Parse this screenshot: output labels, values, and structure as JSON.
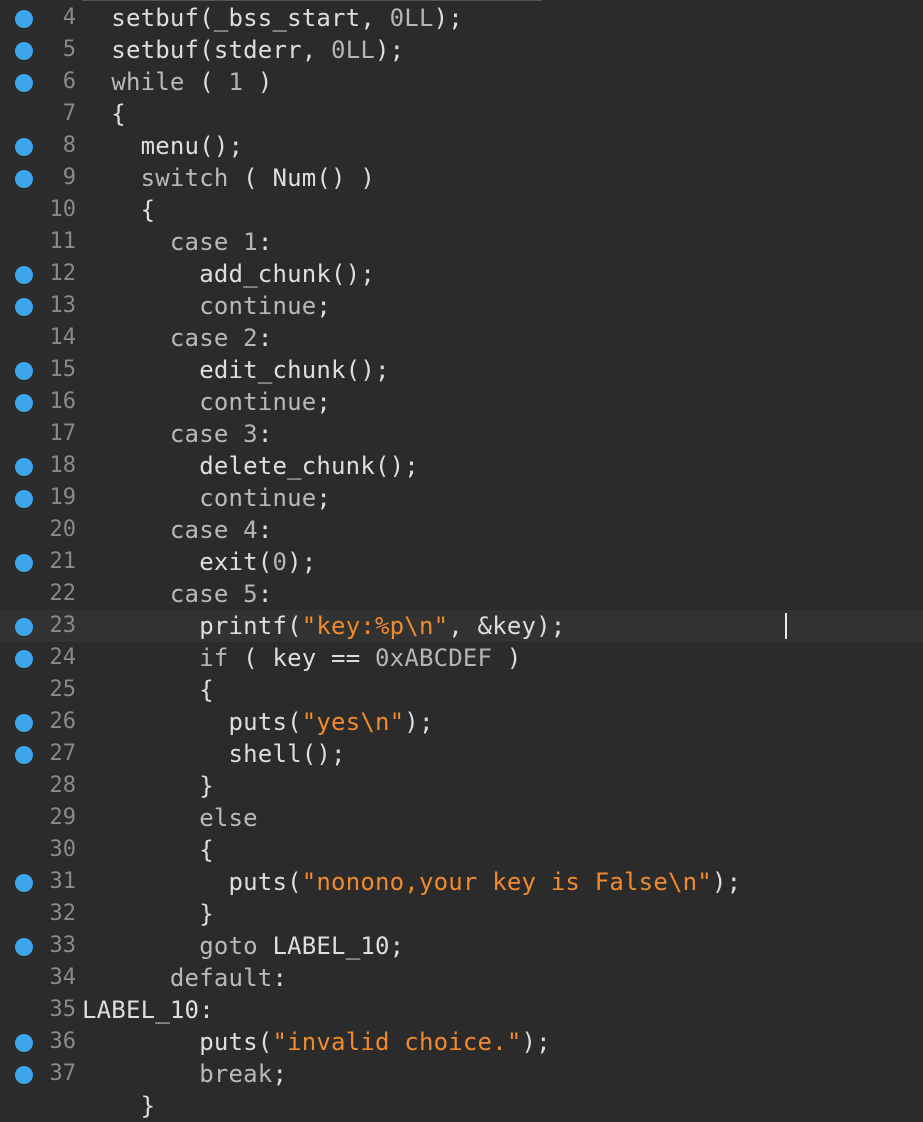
{
  "editor": {
    "lines": [
      {
        "n": "4",
        "bp": true,
        "current": false,
        "parts": [
          {
            "t": "  setbuf(_bss_start, "
          },
          {
            "t": "0LL",
            "c": "num"
          },
          {
            "t": ");"
          }
        ]
      },
      {
        "n": "5",
        "bp": true,
        "current": false,
        "parts": [
          {
            "t": "  setbuf(stderr, "
          },
          {
            "t": "0LL",
            "c": "num"
          },
          {
            "t": ");"
          }
        ]
      },
      {
        "n": "6",
        "bp": true,
        "current": false,
        "parts": [
          {
            "t": "  "
          },
          {
            "t": "while",
            "c": "kw"
          },
          {
            "t": " ( "
          },
          {
            "t": "1",
            "c": "num"
          },
          {
            "t": " )"
          }
        ]
      },
      {
        "n": "7",
        "bp": false,
        "current": false,
        "parts": [
          {
            "t": "  {"
          }
        ]
      },
      {
        "n": "8",
        "bp": true,
        "current": false,
        "parts": [
          {
            "t": "    menu();"
          }
        ]
      },
      {
        "n": "9",
        "bp": true,
        "current": false,
        "parts": [
          {
            "t": "    "
          },
          {
            "t": "switch",
            "c": "kw"
          },
          {
            "t": " ( Num() )"
          }
        ]
      },
      {
        "n": "10",
        "bp": false,
        "current": false,
        "parts": [
          {
            "t": "    {"
          }
        ]
      },
      {
        "n": "11",
        "bp": false,
        "current": false,
        "parts": [
          {
            "t": "      "
          },
          {
            "t": "case",
            "c": "kw"
          },
          {
            "t": " "
          },
          {
            "t": "1",
            "c": "num"
          },
          {
            "t": ":"
          }
        ]
      },
      {
        "n": "12",
        "bp": true,
        "current": false,
        "parts": [
          {
            "t": "        add_chunk();"
          }
        ]
      },
      {
        "n": "13",
        "bp": true,
        "current": false,
        "parts": [
          {
            "t": "        "
          },
          {
            "t": "continue",
            "c": "kw"
          },
          {
            "t": ";"
          }
        ]
      },
      {
        "n": "14",
        "bp": false,
        "current": false,
        "parts": [
          {
            "t": "      "
          },
          {
            "t": "case",
            "c": "kw"
          },
          {
            "t": " "
          },
          {
            "t": "2",
            "c": "num"
          },
          {
            "t": ":"
          }
        ]
      },
      {
        "n": "15",
        "bp": true,
        "current": false,
        "parts": [
          {
            "t": "        edit_chunk();"
          }
        ]
      },
      {
        "n": "16",
        "bp": true,
        "current": false,
        "parts": [
          {
            "t": "        "
          },
          {
            "t": "continue",
            "c": "kw"
          },
          {
            "t": ";"
          }
        ]
      },
      {
        "n": "17",
        "bp": false,
        "current": false,
        "parts": [
          {
            "t": "      "
          },
          {
            "t": "case",
            "c": "kw"
          },
          {
            "t": " "
          },
          {
            "t": "3",
            "c": "num"
          },
          {
            "t": ":"
          }
        ]
      },
      {
        "n": "18",
        "bp": true,
        "current": false,
        "parts": [
          {
            "t": "        delete_chunk();"
          }
        ]
      },
      {
        "n": "19",
        "bp": true,
        "current": false,
        "parts": [
          {
            "t": "        "
          },
          {
            "t": "continue",
            "c": "kw"
          },
          {
            "t": ";"
          }
        ]
      },
      {
        "n": "20",
        "bp": false,
        "current": false,
        "parts": [
          {
            "t": "      "
          },
          {
            "t": "case",
            "c": "kw"
          },
          {
            "t": " "
          },
          {
            "t": "4",
            "c": "num"
          },
          {
            "t": ":"
          }
        ]
      },
      {
        "n": "21",
        "bp": true,
        "current": false,
        "parts": [
          {
            "t": "        exit("
          },
          {
            "t": "0",
            "c": "num"
          },
          {
            "t": ");"
          }
        ]
      },
      {
        "n": "22",
        "bp": false,
        "current": false,
        "parts": [
          {
            "t": "      "
          },
          {
            "t": "case",
            "c": "kw"
          },
          {
            "t": " "
          },
          {
            "t": "5",
            "c": "num"
          },
          {
            "t": ":"
          }
        ]
      },
      {
        "n": "23",
        "bp": true,
        "current": true,
        "parts": [
          {
            "t": "        printf("
          },
          {
            "t": "\"key:%p\\n\"",
            "c": "str"
          },
          {
            "t": ", &key);"
          }
        ]
      },
      {
        "n": "24",
        "bp": true,
        "current": false,
        "parts": [
          {
            "t": "        "
          },
          {
            "t": "if",
            "c": "kw"
          },
          {
            "t": " ( key == "
          },
          {
            "t": "0xABCDEF",
            "c": "num"
          },
          {
            "t": " )"
          }
        ]
      },
      {
        "n": "25",
        "bp": false,
        "current": false,
        "parts": [
          {
            "t": "        {"
          }
        ]
      },
      {
        "n": "26",
        "bp": true,
        "current": false,
        "parts": [
          {
            "t": "          puts("
          },
          {
            "t": "\"yes\\n\"",
            "c": "str"
          },
          {
            "t": ");"
          }
        ]
      },
      {
        "n": "27",
        "bp": true,
        "current": false,
        "parts": [
          {
            "t": "          shell();"
          }
        ]
      },
      {
        "n": "28",
        "bp": false,
        "current": false,
        "parts": [
          {
            "t": "        }"
          }
        ]
      },
      {
        "n": "29",
        "bp": false,
        "current": false,
        "parts": [
          {
            "t": "        "
          },
          {
            "t": "else",
            "c": "kw"
          }
        ]
      },
      {
        "n": "30",
        "bp": false,
        "current": false,
        "parts": [
          {
            "t": "        {"
          }
        ]
      },
      {
        "n": "31",
        "bp": true,
        "current": false,
        "parts": [
          {
            "t": "          puts("
          },
          {
            "t": "\"nonono,your key is False\\n\"",
            "c": "str"
          },
          {
            "t": ");"
          }
        ]
      },
      {
        "n": "32",
        "bp": false,
        "current": false,
        "parts": [
          {
            "t": "        }"
          }
        ]
      },
      {
        "n": "33",
        "bp": true,
        "current": false,
        "parts": [
          {
            "t": "        "
          },
          {
            "t": "goto",
            "c": "kw"
          },
          {
            "t": " LABEL_10;"
          }
        ]
      },
      {
        "n": "34",
        "bp": false,
        "current": false,
        "parts": [
          {
            "t": "      "
          },
          {
            "t": "default",
            "c": "kw"
          },
          {
            "t": ":"
          }
        ]
      },
      {
        "n": "35",
        "bp": false,
        "current": false,
        "parts": [
          {
            "t": "LABEL_10:"
          }
        ]
      },
      {
        "n": "36",
        "bp": true,
        "current": false,
        "parts": [
          {
            "t": "        puts("
          },
          {
            "t": "\"invalid choice.\"",
            "c": "str"
          },
          {
            "t": ");"
          }
        ]
      },
      {
        "n": "37",
        "bp": true,
        "current": false,
        "parts": [
          {
            "t": "        "
          },
          {
            "t": "break",
            "c": "kw"
          },
          {
            "t": ";"
          }
        ]
      },
      {
        "n": "",
        "bp": false,
        "current": false,
        "parts": [
          {
            "t": "    }"
          }
        ]
      }
    ]
  },
  "colors": {
    "background": "#2b2b2b",
    "breakpoint": "#3ea5ec",
    "string": "#f08a2c",
    "text": "#dedede",
    "line_number": "#8a8a8a"
  }
}
